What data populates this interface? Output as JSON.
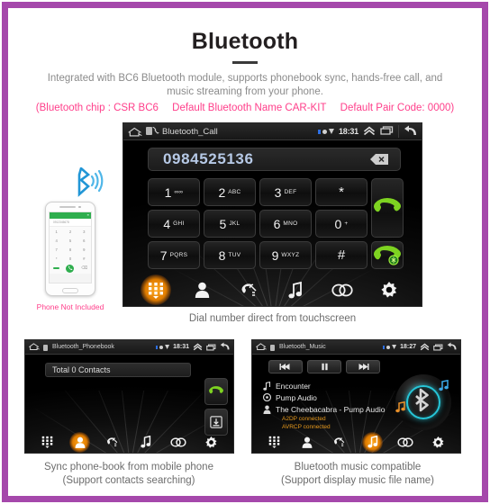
{
  "header": {
    "title": "Bluetooth",
    "subtitle": "Integrated with BC6 Bluetooth module, supports phonebook sync, hands-free call, and music streaming from your phone.",
    "spec_prefix": "(Bluetooth chip : CSR BC6",
    "spec_name": "Default Bluetooth Name CAR-KIT",
    "spec_pair": "Default Pair Code: 0000)"
  },
  "main_screen": {
    "status": {
      "app_label": "Bluetooth_Call",
      "time": "18:31"
    },
    "dialed_number": "0984525136",
    "keys": [
      {
        "digit": "1",
        "letters": "∞∞"
      },
      {
        "digit": "2",
        "letters": "ABC"
      },
      {
        "digit": "3",
        "letters": "DEF"
      },
      {
        "digit": "*",
        "letters": ""
      },
      {
        "digit": "4",
        "letters": "GHI"
      },
      {
        "digit": "5",
        "letters": "JKL"
      },
      {
        "digit": "6",
        "letters": "MNO"
      },
      {
        "digit": "0",
        "letters": "+"
      },
      {
        "digit": "7",
        "letters": "PQRS"
      },
      {
        "digit": "8",
        "letters": "TUV"
      },
      {
        "digit": "9",
        "letters": "WXYZ"
      },
      {
        "digit": "#",
        "letters": ""
      }
    ],
    "toolbar": [
      {
        "name": "keypad",
        "active": true
      },
      {
        "name": "contacts",
        "active": false
      },
      {
        "name": "call-history",
        "active": false
      },
      {
        "name": "music",
        "active": false
      },
      {
        "name": "pair-link",
        "active": false
      },
      {
        "name": "settings",
        "active": false
      }
    ],
    "caption": "Dial number direct from touchscreen"
  },
  "phone_mockup": {
    "note": "Phone Not Included",
    "dialer_placeholder": "0912345678",
    "keys": [
      "1",
      "2",
      "3",
      "4",
      "5",
      "6",
      "7",
      "8",
      "9",
      "*",
      "0",
      "#"
    ]
  },
  "phonebook_screen": {
    "status": {
      "app_label": "Bluetooth_Phonebook",
      "time": "18:31"
    },
    "contacts_text": "Total 0 Contacts",
    "caption_line1": "Sync phone-book from mobile phone",
    "caption_line2": "(Support contacts searching)"
  },
  "music_screen": {
    "status": {
      "app_label": "Bluetooth_Music",
      "time": "18:27"
    },
    "track_title": "Encounter",
    "album": "Pump Audio",
    "artist": "The Cheebacabra - Pump Audio",
    "a2dp_status": "A2DP connected",
    "avrcp_status": "AVRCP connected",
    "caption_line1": "Bluetooth music compatible",
    "caption_line2": "(Support display music file name)"
  },
  "colors": {
    "frame_purple": "#a548ab",
    "accent_pink": "#ff3e8a",
    "highlight_orange": "#e07c00",
    "call_green": "#7ed321",
    "bt_cyan": "#26c6d8",
    "number_blue": "#b6c9e6"
  }
}
